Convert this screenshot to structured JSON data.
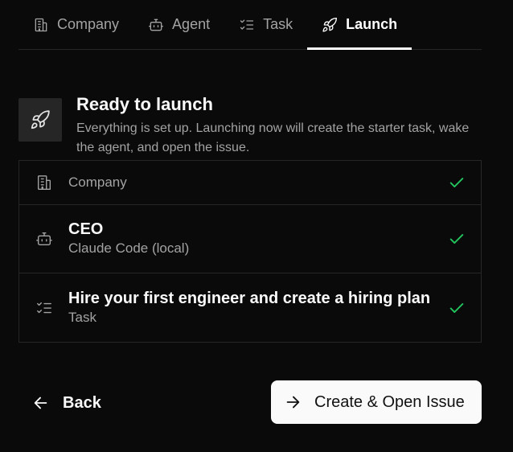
{
  "tabs": [
    {
      "label": "Company",
      "icon": "building-icon",
      "active": false
    },
    {
      "label": "Agent",
      "icon": "bot-icon",
      "active": false
    },
    {
      "label": "Task",
      "icon": "list-checks-icon",
      "active": false
    },
    {
      "label": "Launch",
      "icon": "rocket-icon",
      "active": true
    }
  ],
  "header": {
    "icon": "rocket-icon",
    "title": "Ready to launch",
    "description": "Everything is set up. Launching now will create the starter task, wake the agent, and open the issue."
  },
  "summary": [
    {
      "icon": "building-icon",
      "label": "Company",
      "status": "complete"
    },
    {
      "icon": "bot-icon",
      "title": "CEO",
      "subtitle": "Claude Code (local)",
      "status": "complete"
    },
    {
      "icon": "list-checks-icon",
      "title": "Hire your first engineer and create a hiring plan",
      "subtitle": "Task",
      "status": "complete"
    }
  ],
  "actions": {
    "back_label": "Back",
    "primary_label": "Create & Open Issue"
  },
  "colors": {
    "background": "#0a0a0a",
    "check": "#22c55e",
    "primary_button": "#fafafa"
  }
}
